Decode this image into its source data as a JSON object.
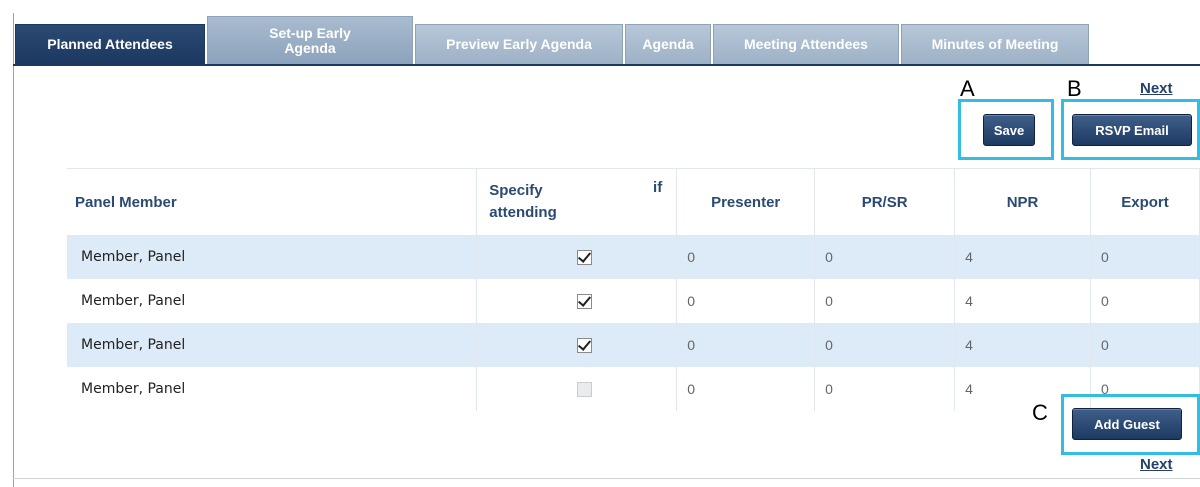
{
  "tabs": [
    {
      "label": "Planned Attendees",
      "active": true
    },
    {
      "label": "Set-up Early\nAgenda",
      "active": false
    },
    {
      "label": "Preview Early Agenda",
      "active": false
    },
    {
      "label": "Agenda",
      "active": false
    },
    {
      "label": "Meeting Attendees",
      "active": false
    },
    {
      "label": "Minutes of Meeting",
      "active": false
    }
  ],
  "actions": {
    "next_top": "Next",
    "save": "Save",
    "rsvp_email": "RSVP Email",
    "add_guest": "Add Guest",
    "next_bottom": "Next"
  },
  "callouts": {
    "a": "A",
    "b": "B",
    "c": "C"
  },
  "table": {
    "headers": {
      "panel_member": "Panel Member",
      "specify": "Specify\nattending",
      "specify_if": "if",
      "presenter": "Presenter",
      "pr_sr": "PR/SR",
      "npr": "NPR",
      "export": "Export"
    },
    "rows": [
      {
        "name": "Member, Panel",
        "attending": true,
        "presenter": "0",
        "pr_sr": "0",
        "npr": "4",
        "export": "0"
      },
      {
        "name": "Member, Panel",
        "attending": true,
        "presenter": "0",
        "pr_sr": "0",
        "npr": "4",
        "export": "0"
      },
      {
        "name": "Member, Panel",
        "attending": true,
        "presenter": "0",
        "pr_sr": "0",
        "npr": "4",
        "export": "0"
      },
      {
        "name": "Member, Panel",
        "attending": false,
        "presenter": "0",
        "pr_sr": "0",
        "npr": "4",
        "export": "0"
      }
    ]
  },
  "colors": {
    "accent": "#1c3860",
    "callout": "#33bde3",
    "row_alt": "#dcebf7"
  }
}
